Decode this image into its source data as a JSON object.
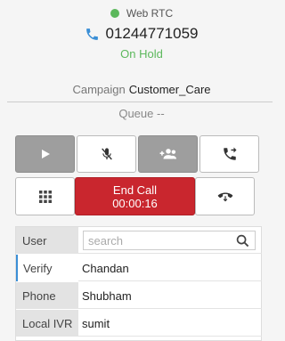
{
  "status": {
    "label": "Web RTC",
    "color": "#5cb85c"
  },
  "call": {
    "number": "01244771059",
    "state": "On Hold"
  },
  "campaign": {
    "label": "Campaign",
    "value": "Customer_Care"
  },
  "queue": {
    "label": "Queue",
    "value": "--"
  },
  "controls": {
    "play": {
      "icon": "play-icon"
    },
    "mute": {
      "icon": "mic-off-icon"
    },
    "conference": {
      "icon": "add-group-icon"
    },
    "transfer": {
      "icon": "call-forward-icon"
    },
    "dialpad": {
      "icon": "dialpad-icon"
    },
    "end_call": {
      "label": "End Call",
      "timer": "00:00:16",
      "color": "#c9262e"
    },
    "hangup": {
      "icon": "hangup-icon"
    }
  },
  "details": {
    "search_placeholder": "search",
    "rows": [
      {
        "label": "User",
        "value": ""
      },
      {
        "label": "Verify",
        "value": "Chandan"
      },
      {
        "label": "Phone",
        "value": "Shubham"
      },
      {
        "label": "Local IVR",
        "value": "sumit"
      }
    ]
  }
}
